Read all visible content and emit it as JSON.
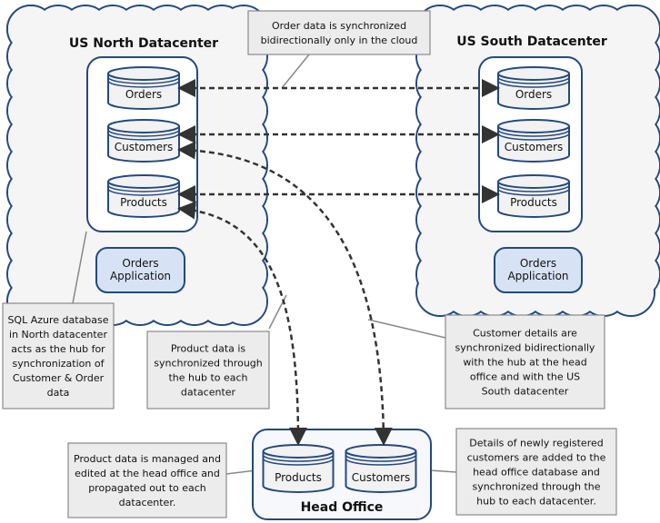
{
  "colors": {
    "outline": "#24497e",
    "cloud_fill": "#f5f5f5",
    "app_fill": "#d7e3f5",
    "note_fill": "#ececec",
    "note_stroke": "#8a8a8a",
    "arrow": "#333333"
  },
  "north": {
    "title": "US North Datacenter",
    "dbs": [
      "Orders",
      "Customers",
      "Products"
    ],
    "app": [
      "Orders",
      "Application"
    ]
  },
  "south": {
    "title": "US South Datacenter",
    "dbs": [
      "Orders",
      "Customers",
      "Products"
    ],
    "app": [
      "Orders",
      "Application"
    ]
  },
  "head": {
    "title": "Head Office",
    "dbs": [
      "Products",
      "Customers"
    ]
  },
  "notes": {
    "top": [
      "Order data is synchronized",
      "bidirectionally only in the cloud"
    ],
    "hub": [
      "SQL Azure database",
      "in North datacenter",
      "acts as the hub for",
      "synchronization of",
      "Customer & Order",
      "data"
    ],
    "product": [
      "Product data is",
      "synchronized through",
      "the hub to each",
      "datacenter"
    ],
    "customer": [
      "Customer details are",
      "synchronized bidirectionally",
      "with the hub at the head",
      "office and with the US",
      "South datacenter"
    ],
    "managed": [
      "Product data is managed and",
      "edited at the head office and",
      "propagated out to each",
      "datacenter."
    ],
    "registered": [
      "Details of newly registered",
      "customers are added to the",
      "head office database and",
      "synchronized through the",
      "hub to each datacenter."
    ]
  }
}
